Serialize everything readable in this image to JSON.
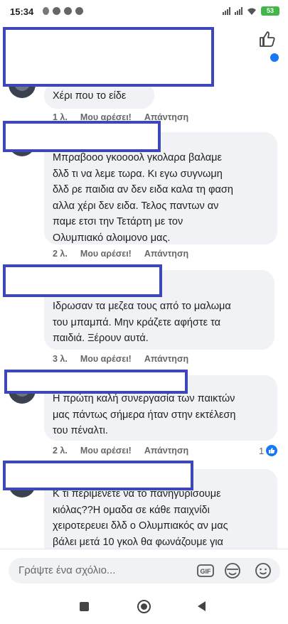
{
  "status_bar": {
    "time": "15:34",
    "battery": "53"
  },
  "comments": [
    {
      "text": "Χέρι  που το είδε",
      "time": "1 λ.",
      "like_label": "Μου αρέσει!",
      "reply_label": "Απάντηση"
    },
    {
      "text": "Μπραβοοο γκοοοολ γκολαρα βαλαμε\nδλδ τι να λεμε τωρα. Κι εγω συγνωμη\nδλδ ρε παιδια αν δεν ειδα καλα τη φαση\nαλλα χέρι δεν ειδα. Τελος παντων αν\nπαμε ετσι την Τετάρτη με τον\nΟλυμπιακό αλοιμονο μας.",
      "time": "2 λ.",
      "like_label": "Μου αρέσει!",
      "reply_label": "Απάντηση"
    },
    {
      "text": "Ιδρωσαν τα μεζεα τους από το μαλωμα\nτου μπαμπά. Μην κράζετε αφήστε τα\nπαιδιά. Ξέρουν αυτά.",
      "time": "3 λ.",
      "like_label": "Μου αρέσει!",
      "reply_label": "Απάντηση"
    },
    {
      "text": "Η πρώτη καλή συνεργασία των παικτών\nμας πάντως σήμερα ήταν στην εκτέλεση\nτου πέναλτι.",
      "time": "2 λ.",
      "like_label": "Μου αρέσει!",
      "reply_label": "Απάντηση",
      "reaction_count": "1"
    },
    {
      "text": "Κ τι περιμένετε να το πανηγυρίσουμε\nκιόλας??Η ομαδα σε κάθε παιχνίδι\nχειροτερευει δλδ ο Ολυμπιακός αν μας\nβάλει μετά 10 γκολ θα φωνάζουμε για",
      "time": "",
      "like_label": "",
      "reply_label": ""
    }
  ],
  "composer": {
    "placeholder": "Γράψτε ένα σχόλιο...",
    "gif_label": "GIF"
  },
  "colors": {
    "accent": "#1877f2",
    "redaction_border": "#3d47b8",
    "bubble": "#f0f2f5"
  }
}
